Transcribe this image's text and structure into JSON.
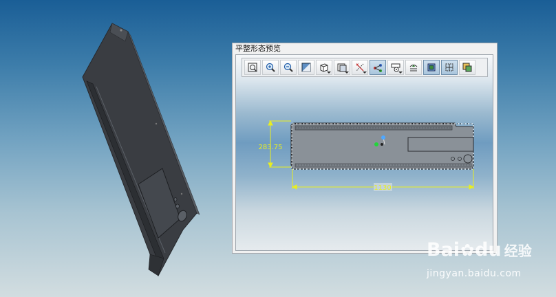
{
  "preview_window": {
    "title": "平整形态预览",
    "toolbar": [
      {
        "icon": "zoom-fit-icon",
        "label": "zoom-fit-button",
        "active": false,
        "dropdown": false
      },
      {
        "icon": "zoom-in-icon",
        "label": "zoom-in-button",
        "active": false,
        "dropdown": false
      },
      {
        "icon": "zoom-out-icon",
        "label": "zoom-out-button",
        "active": false,
        "dropdown": false
      },
      {
        "icon": "normal-view-icon",
        "label": "normal-view-button",
        "active": false,
        "dropdown": false
      },
      {
        "icon": "isometric-view-icon",
        "label": "view-dropdown-button",
        "active": false,
        "dropdown": true
      },
      {
        "icon": "render-style-icon",
        "label": "render-style-button",
        "active": false,
        "dropdown": true
      },
      {
        "icon": "axes-icon",
        "label": "axes-button",
        "active": false,
        "dropdown": true
      },
      {
        "icon": "bend-lines-icon",
        "label": "bend-lines-button",
        "active": true,
        "dropdown": false
      },
      {
        "icon": "dimension-icon",
        "label": "dimension-button",
        "active": false,
        "dropdown": true
      },
      {
        "icon": "align-icon",
        "label": "align-button",
        "active": false,
        "dropdown": false
      },
      {
        "icon": "hide-show-icon",
        "label": "hide-show-button",
        "active": true,
        "dropdown": false
      },
      {
        "icon": "bounding-box-icon",
        "label": "bounding-box-button",
        "active": true,
        "dropdown": false
      },
      {
        "icon": "export-icon",
        "label": "export-button",
        "active": false,
        "dropdown": false
      }
    ],
    "dimensions": {
      "height_label": "283.75",
      "width_label": "1130"
    }
  },
  "colors": {
    "dimension": "#e8ee20",
    "part": "#8a9198",
    "part_edge": "#2a2c30",
    "model": "#3a3d42",
    "origin_green": "#22d63a",
    "origin_blue": "#4fa8ff"
  },
  "watermark": {
    "logo_left": "Bai",
    "logo_right": "经验",
    "paw": "du",
    "url": "jingyan.baidu.com"
  }
}
